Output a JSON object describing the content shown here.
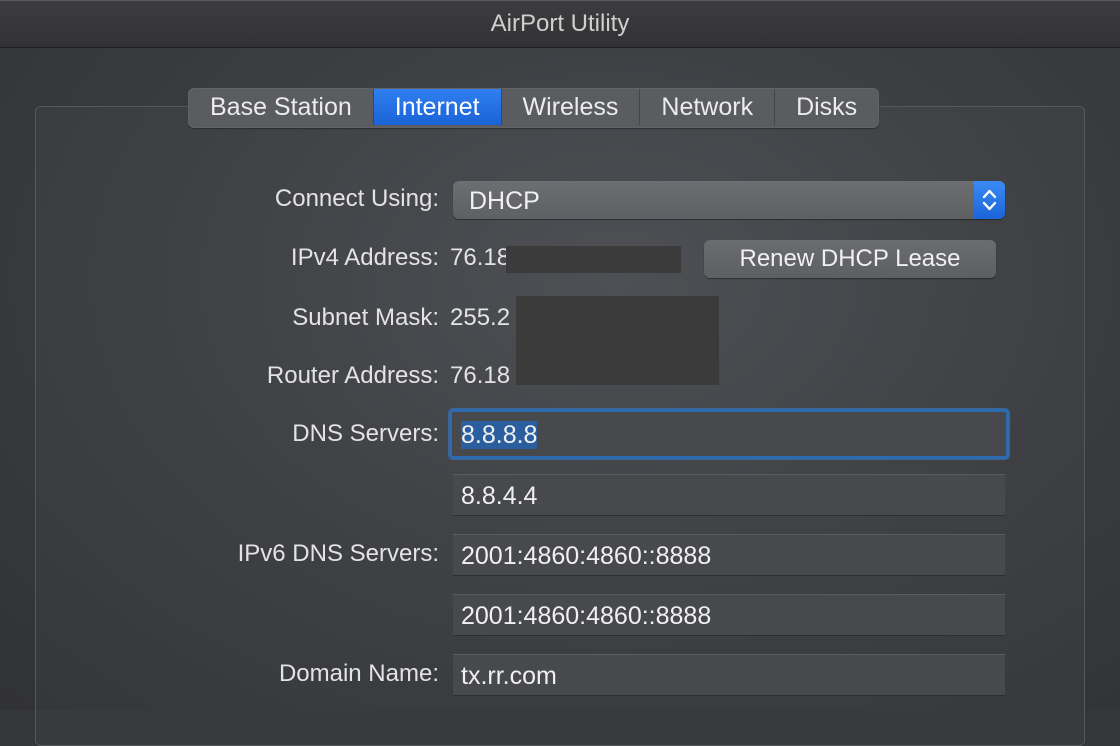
{
  "window": {
    "title": "AirPort Utility"
  },
  "tabs": [
    {
      "label": "Base Station",
      "active": false
    },
    {
      "label": "Internet",
      "active": true
    },
    {
      "label": "Wireless",
      "active": false
    },
    {
      "label": "Network",
      "active": false
    },
    {
      "label": "Disks",
      "active": false
    }
  ],
  "form": {
    "connect_using": {
      "label": "Connect Using:",
      "value": "DHCP"
    },
    "ipv4": {
      "label": "IPv4 Address:",
      "value": "76.18"
    },
    "renew_button": "Renew DHCP Lease",
    "subnet": {
      "label": "Subnet Mask:",
      "value": "255.2"
    },
    "router": {
      "label": "Router Address:",
      "value": "76.18"
    },
    "dns": {
      "label": "DNS Servers:",
      "primary": "8.8.8.8",
      "secondary": "8.8.4.4"
    },
    "ipv6_dns": {
      "label": "IPv6 DNS Servers:",
      "primary": "2001:4860:4860::8888",
      "secondary": "2001:4860:4860::8888"
    },
    "domain": {
      "label": "Domain Name:",
      "value": "tx.rr.com"
    }
  },
  "colors": {
    "accent": "#1a63d6",
    "focus_ring": "#2d6bb0",
    "background": "#34363a"
  },
  "icons": {
    "stepper": "up-down-chevron-icon"
  }
}
